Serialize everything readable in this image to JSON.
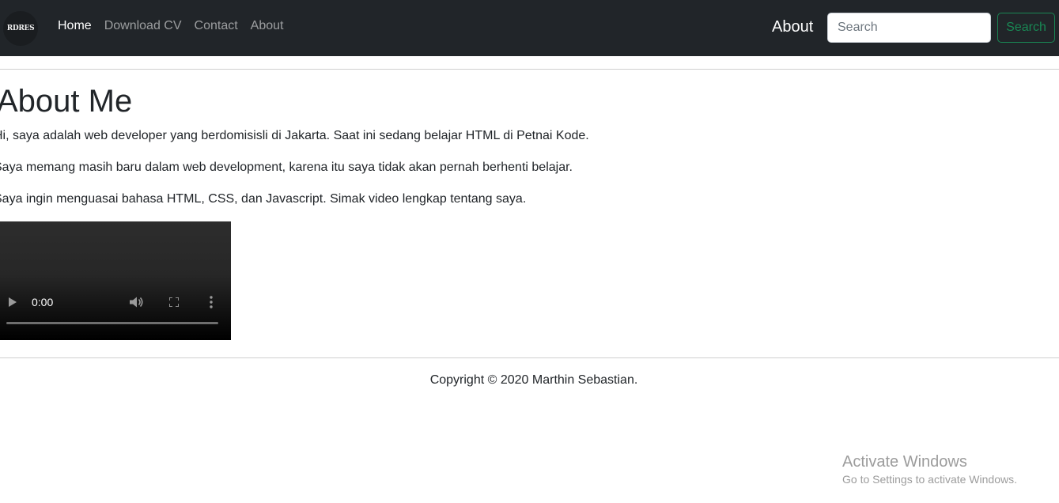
{
  "navbar": {
    "logo_text": "RDRES",
    "links": [
      {
        "label": "Home",
        "active": true
      },
      {
        "label": "Download CV",
        "active": false
      },
      {
        "label": "Contact",
        "active": false
      },
      {
        "label": "About",
        "active": false
      }
    ],
    "brand_right": "About",
    "search": {
      "placeholder": "Search",
      "value": ""
    },
    "search_button": "Search",
    "colors": {
      "background": "#212529",
      "button": "#198754"
    }
  },
  "main": {
    "title": "About Me",
    "paragraphs": [
      "Hi, saya adalah web developer yang berdomisisli di Jakarta. Saat ini sedang belajar HTML di Petnai Kode.",
      "Saya memang masih baru dalam web development, karena itu saya tidak akan pernah berhenti belajar.",
      "Saya ingin menguasai bahasa HTML, CSS, dan Javascript. Simak video lengkap tentang saya."
    ],
    "video": {
      "time": "0:00",
      "progress": 0
    }
  },
  "footer": {
    "copyright": "Copyright © 2020 Marthin Sebastian."
  },
  "watermark": {
    "title": "Activate Windows",
    "subtitle": "Go to Settings to activate Windows."
  }
}
